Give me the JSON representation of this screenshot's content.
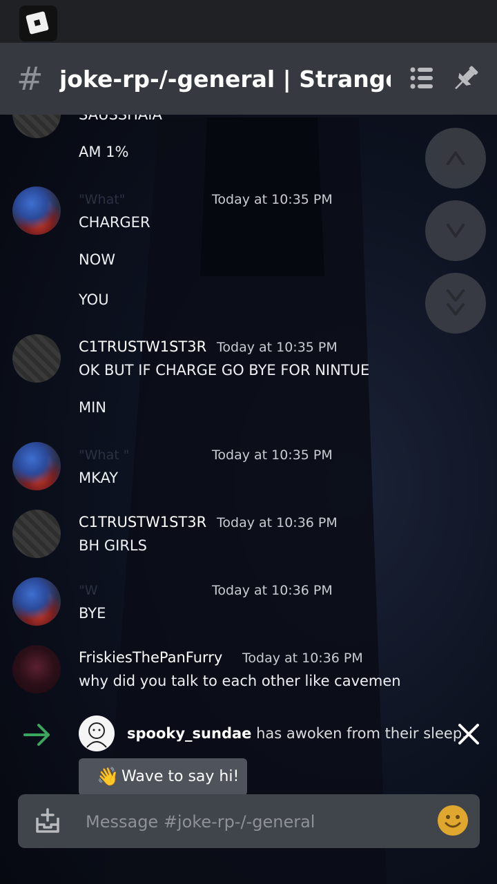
{
  "header": {
    "hash_symbol": "#",
    "channel_title": "joke-rp-/-general | Stranger…",
    "icons": [
      "list-icon",
      "pin-icon"
    ]
  },
  "messages": {
    "cut_top_text": "SAUSSHAIA",
    "am_line": "AM 1%",
    "group1": {
      "ghost_name": "\"What\"",
      "time": "Today at 10:35 PM",
      "lines": [
        "CHARGER",
        "NOW",
        "YOU"
      ]
    },
    "group2": {
      "username": "C1TRUSTW1ST3R",
      "time": "Today at 10:35 PM",
      "lines": [
        "OK BUT IF CHARGE GO BYE FOR NINTUE",
        "MIN"
      ]
    },
    "group3": {
      "ghost_name": "\"What \"",
      "time": "Today at 10:35 PM",
      "lines": [
        "MKAY"
      ]
    },
    "group4": {
      "username": "C1TRUSTW1ST3R",
      "time": "Today at 10:36 PM",
      "lines": [
        "BH GIRLS"
      ]
    },
    "group5": {
      "ghost_name": "\"W",
      "time": "Today at 10:36 PM",
      "lines": [
        "BYE"
      ]
    },
    "group6": {
      "username": "FriskiesThePanFurry",
      "time": "Today at 10:36 PM",
      "lines": [
        "why did you talk to each other like cavemen"
      ]
    }
  },
  "join": {
    "username": "spooky_sundae",
    "text": " has awoken from their sleep.",
    "wave_emoji": "👋",
    "wave_label": "Wave to say hi!"
  },
  "composer": {
    "placeholder": "Message #joke-rp-/-general"
  },
  "colors": {
    "header_bg": "#36393f",
    "composer_bg": "#40444b",
    "join_arrow": "#3ba55d",
    "emoji_yellow": "#e0a72e"
  }
}
